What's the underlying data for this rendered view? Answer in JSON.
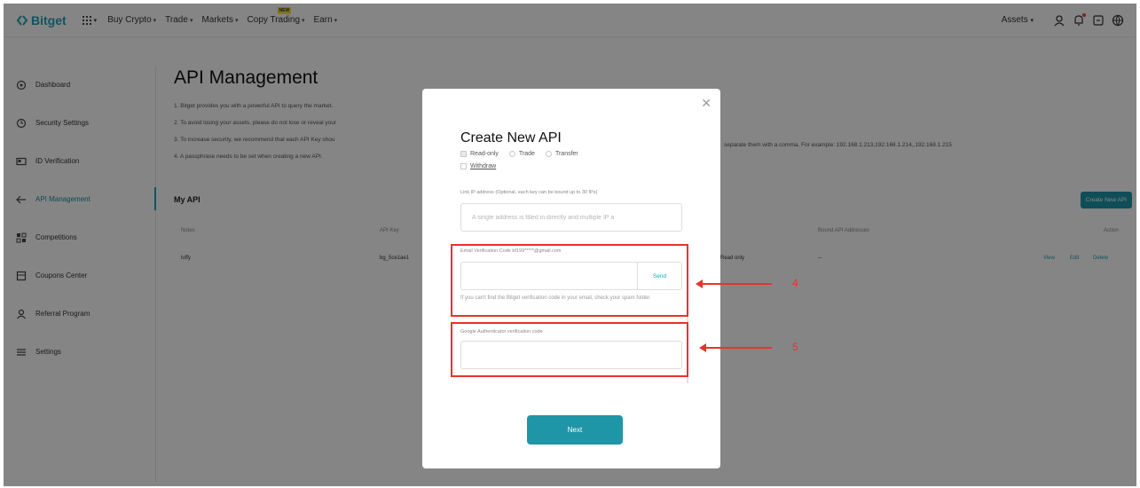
{
  "brand": {
    "name": "Bitget",
    "accent": "#1fa3b6"
  },
  "nav": {
    "items": [
      {
        "label": "Buy Crypto"
      },
      {
        "label": "Trade"
      },
      {
        "label": "Markets"
      },
      {
        "label": "Copy Trading",
        "badge": "NEW"
      },
      {
        "label": "Earn"
      }
    ],
    "assets": "Assets"
  },
  "sidebar": {
    "items": [
      {
        "label": "Dashboard",
        "icon": "dashboard-icon"
      },
      {
        "label": "Security Settings",
        "icon": "shield-icon"
      },
      {
        "label": "ID Verification",
        "icon": "id-card-icon"
      },
      {
        "label": "API Management",
        "icon": "api-icon",
        "active": true
      },
      {
        "label": "Competitions",
        "icon": "trophy-icon"
      },
      {
        "label": "Coupons Center",
        "icon": "coupon-icon"
      },
      {
        "label": "Referral Program",
        "icon": "user-icon"
      },
      {
        "label": "Settings",
        "icon": "settings-icon"
      }
    ]
  },
  "main": {
    "title": "API Management",
    "notes": [
      "1. Bitget provides you with a powerful API to query the market.",
      "2. To avoid losing your assets, please do not lose or reveal your",
      "3. To increase security, we recommend that each API Key shou",
      "4. A passphrase needs to be set when creating a new API."
    ],
    "notes_tail": "separate them with a comma. For example: 192.168.1.213,192.168.1.214,,192.168.1.215",
    "my_api": "My API",
    "create_button": "Create New API",
    "table": {
      "headers": [
        "Notes",
        "API Key",
        "Bound API Addresses",
        "Action"
      ],
      "row": {
        "notes": "luffy",
        "api_key": "bg_5ce1ae1",
        "permission": "Read only",
        "bound": "--",
        "actions": [
          "View",
          "Edit",
          "Delete"
        ]
      }
    }
  },
  "modal": {
    "title": "Create New API",
    "permissions": [
      {
        "label": "Read-only",
        "checked": true
      },
      {
        "label": "Trade",
        "checked": false
      },
      {
        "label": "Transfer",
        "checked": false
      },
      {
        "label": "Withdraw",
        "checked": false
      }
    ],
    "ip_label": "Link IP address  (Optional, each key can be bound up to 30 IPs)",
    "ip_placeholder": "A single address is filled in directly and multiple IP a",
    "email_label": "Email Verification Code bf199*****@gmail.com",
    "send": "Send",
    "email_hint": "If you can't find the Bitget verification code in your email, check your spam folder.",
    "google_label": "Google Authenticator verification code",
    "next": "Next"
  },
  "annotations": {
    "email_step": "4",
    "google_step": "5",
    "color": "#e8322d"
  }
}
